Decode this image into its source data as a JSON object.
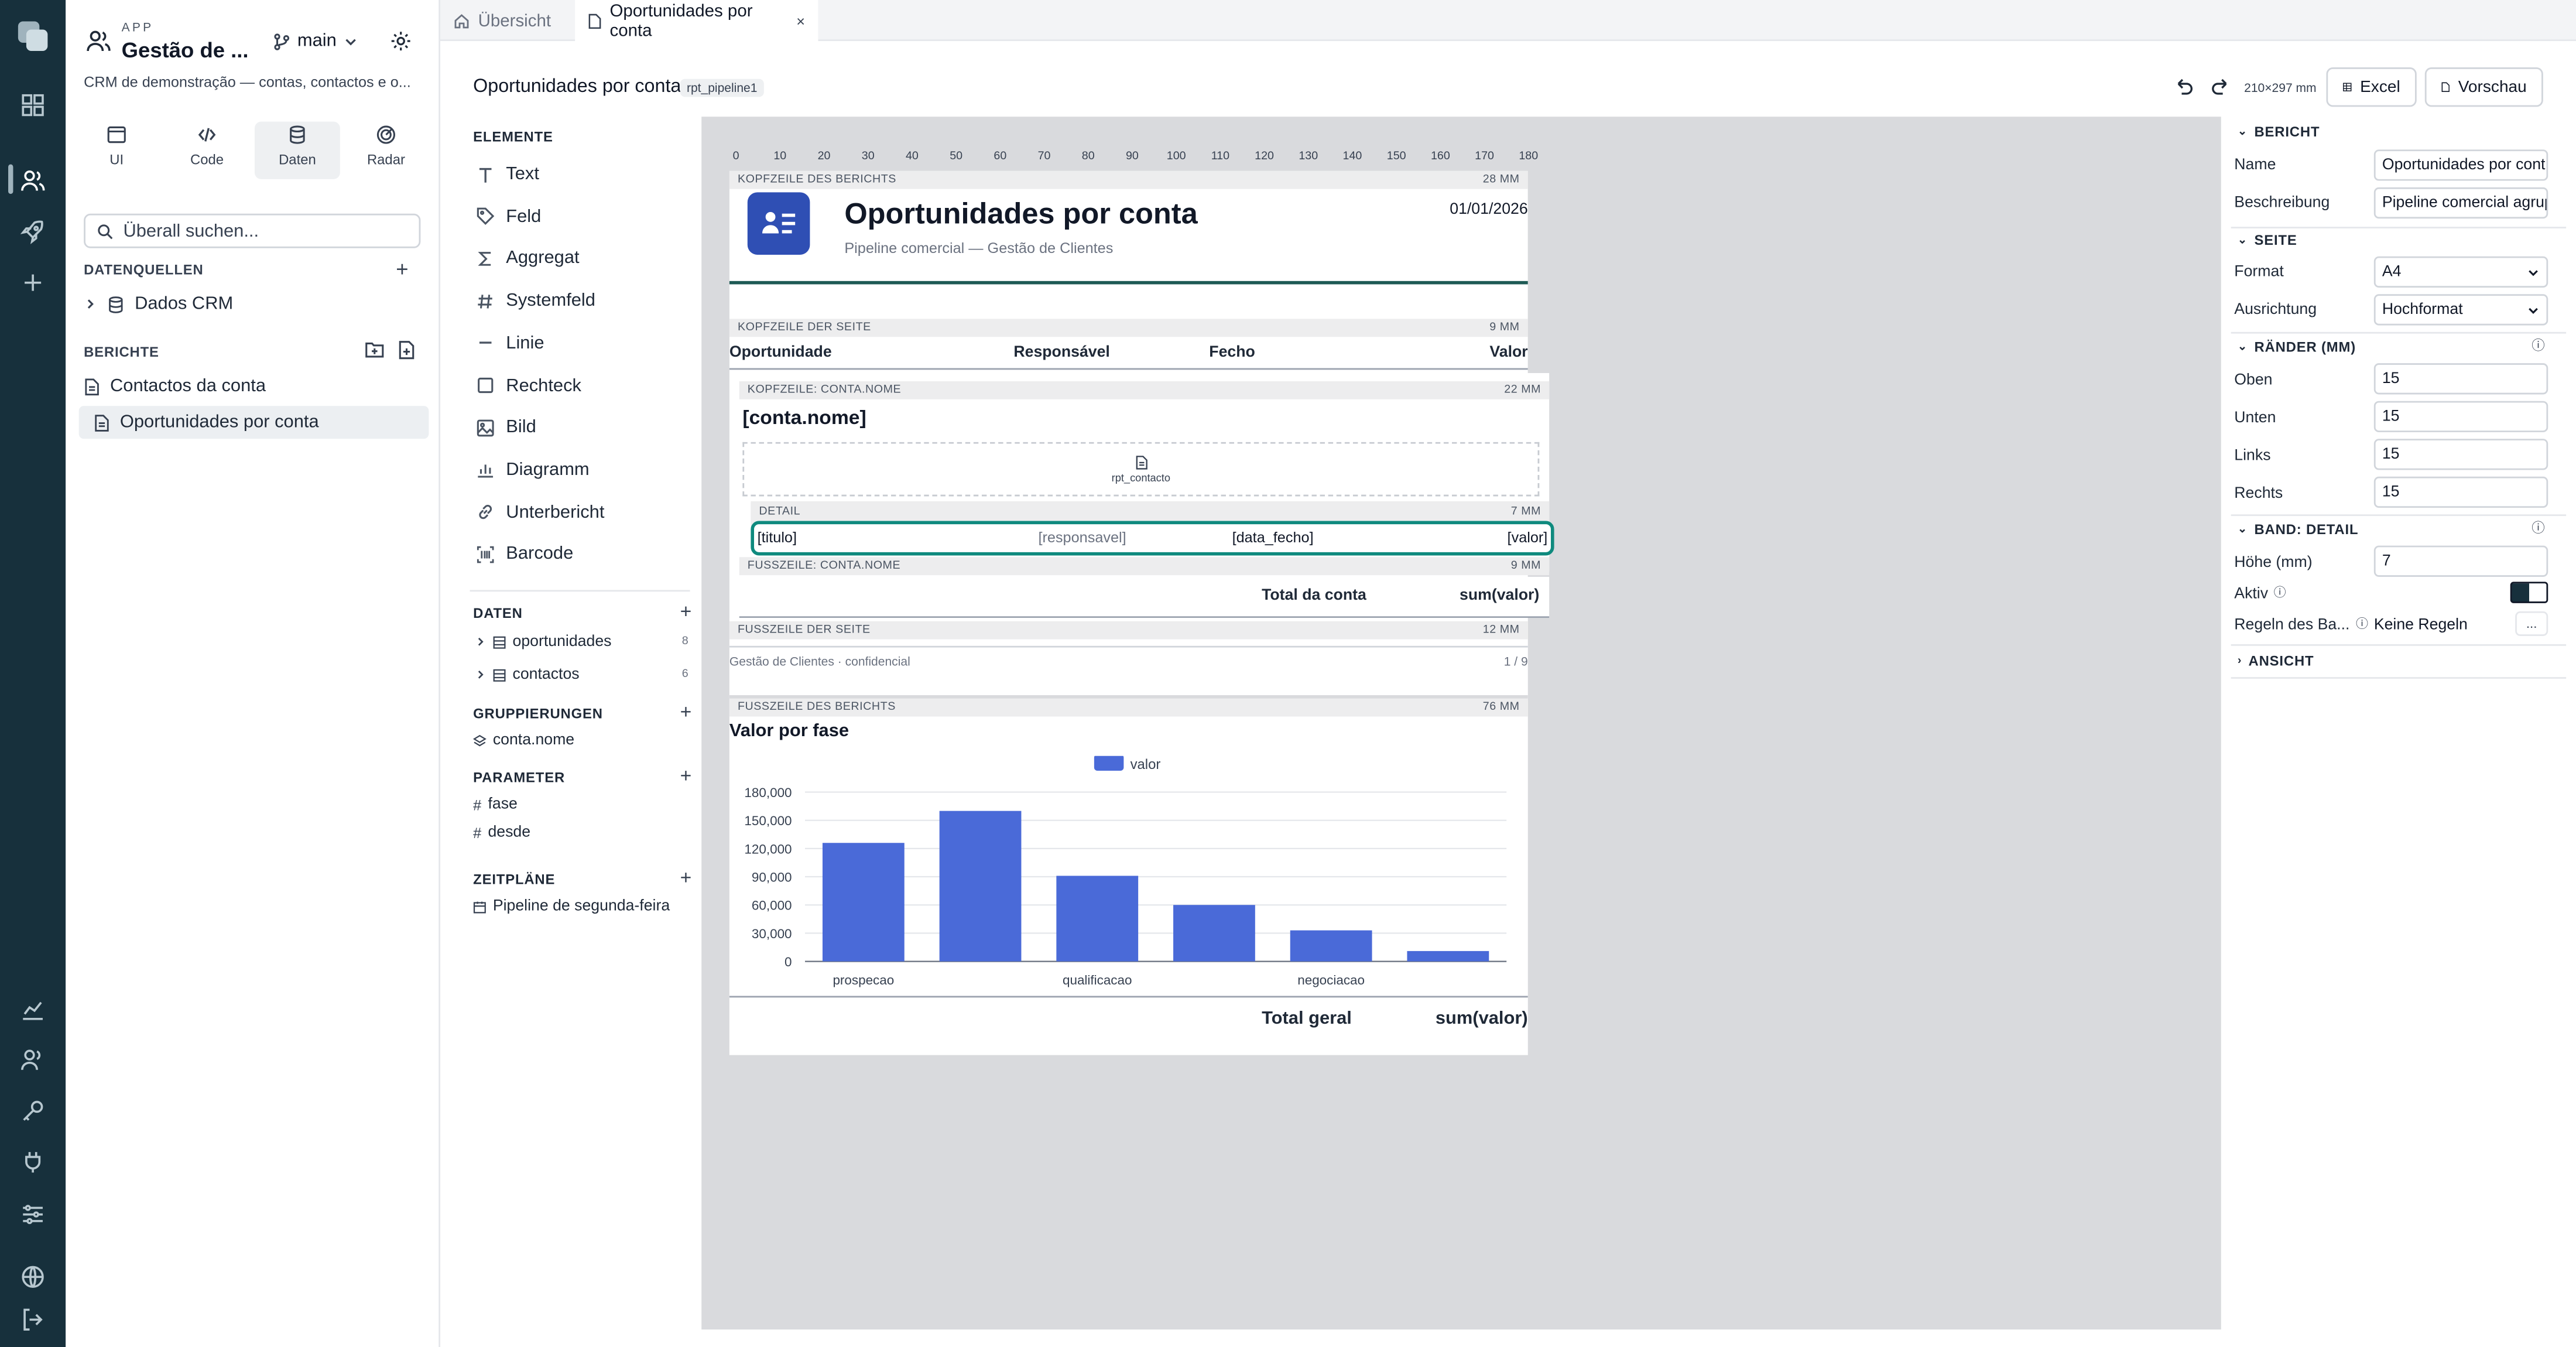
{
  "app": {
    "eyebrow": "APP",
    "title": "Gestão de ...",
    "branch": "main",
    "description": "CRM de demonstração — contas, contactos e o..."
  },
  "modes": [
    {
      "label": "UI"
    },
    {
      "label": "Code"
    },
    {
      "label": "Daten"
    },
    {
      "label": "Radar"
    }
  ],
  "search": {
    "placeholder": "Überall suchen..."
  },
  "datasources": {
    "heading": "DATENQUELLEN",
    "items": [
      {
        "label": "Dados CRM"
      }
    ]
  },
  "reports": {
    "heading": "BERICHTE",
    "items": [
      {
        "label": "Contactos da conta"
      },
      {
        "label": "Oportunidades por conta"
      }
    ]
  },
  "tabs": [
    {
      "label": "Übersicht"
    },
    {
      "label": "Oportunidades por conta"
    }
  ],
  "toolbar": {
    "title": "Oportunidades por conta",
    "badge": "rpt_pipeline1",
    "page_size": "210×297 mm",
    "excel": "Excel",
    "preview": "Vorschau"
  },
  "elements": {
    "heading": "ELEMENTE",
    "items": [
      {
        "label": "Text",
        "icon": "text-icon"
      },
      {
        "label": "Feld",
        "icon": "tag-icon"
      },
      {
        "label": "Aggregat",
        "icon": "sigma-icon"
      },
      {
        "label": "Systemfeld",
        "icon": "hash-icon"
      },
      {
        "label": "Linie",
        "icon": "line-icon"
      },
      {
        "label": "Rechteck",
        "icon": "rectangle-icon"
      },
      {
        "label": "Bild",
        "icon": "image-icon"
      },
      {
        "label": "Diagramm",
        "icon": "chart-icon"
      },
      {
        "label": "Unterbericht",
        "icon": "link-icon"
      },
      {
        "label": "Barcode",
        "icon": "barcode-icon"
      }
    ]
  },
  "data_section": {
    "heading": "DATEN",
    "items": [
      {
        "label": "oportunidades",
        "count": "8"
      },
      {
        "label": "contactos",
        "count": "6"
      }
    ]
  },
  "groupings": {
    "heading": "GRUPPIERUNGEN",
    "items": [
      {
        "label": "conta.nome"
      }
    ]
  },
  "parameters": {
    "heading": "PARAMETER",
    "items": [
      {
        "label": "fase"
      },
      {
        "label": "desde"
      }
    ]
  },
  "schedules": {
    "heading": "ZEITPLÄNE",
    "items": [
      {
        "label": "Pipeline de segunda-feira"
      }
    ]
  },
  "ruler": [
    "0",
    "10",
    "20",
    "30",
    "40",
    "50",
    "60",
    "70",
    "80",
    "90",
    "100",
    "110",
    "120",
    "130",
    "140",
    "150",
    "160",
    "170",
    "180"
  ],
  "report": {
    "report_header": {
      "label": "KOPFZEILE DES BERICHTS",
      "height": "28 MM",
      "title": "Oportunidades por conta",
      "subtitle": "Pipeline comercial — Gestão de Clientes",
      "date": "01/01/2026"
    },
    "page_header": {
      "label": "KOPFZEILE DER SEITE",
      "height": "9 MM",
      "columns": [
        "Oportunidade",
        "Responsável",
        "Fecho",
        "Valor"
      ]
    },
    "group_header": {
      "label": "KOPFZEILE: CONTA.NOME",
      "height": "22 MM",
      "field": "[conta.nome]",
      "subreport": "rpt_contacto"
    },
    "detail": {
      "label": "DETAIL",
      "height": "7 MM",
      "fields": [
        "[titulo]",
        "[responsavel]",
        "[data_fecho]",
        "[valor]"
      ]
    },
    "group_footer": {
      "label": "FUSSZEILE: CONTA.NOME",
      "height": "9 MM",
      "total_label": "Total da conta",
      "total_value": "sum(valor)"
    },
    "page_footer": {
      "label": "FUSSZEILE DER SEITE",
      "height": "12 MM",
      "text": "Gestão de Clientes · confidencial",
      "page": "1 / 9"
    },
    "report_footer": {
      "label": "FUSSZEILE DES BERICHTS",
      "height": "76 MM",
      "chart_title": "Valor por fase",
      "total_label": "Total geral",
      "total_value": "sum(valor)"
    }
  },
  "chart_data": {
    "type": "bar",
    "title": "Valor por fase",
    "categories": [
      "prospecao",
      "",
      "qualificacao",
      "",
      "negociacao",
      ""
    ],
    "series": [
      {
        "name": "valor",
        "values": [
          126000,
          160000,
          91000,
          60000,
          33000,
          11000
        ]
      }
    ],
    "yticks": [
      "180,000",
      "150,000",
      "120,000",
      "90,000",
      "60,000",
      "30,000",
      "0"
    ],
    "ylim": [
      0,
      180000
    ],
    "grid": true,
    "legend": "top-center",
    "color": "#4a6ad8"
  },
  "properties": {
    "bericht": {
      "heading": "BERICHT",
      "name_label": "Name",
      "name_value": "Oportunidades por cont",
      "desc_label": "Beschreibung",
      "desc_value": "Pipeline comercial agrup"
    },
    "seite": {
      "heading": "SEITE",
      "format_label": "Format",
      "format_value": "A4",
      "orient_label": "Ausrichtung",
      "orient_value": "Hochformat"
    },
    "raender": {
      "heading": "RÄNDER (MM)",
      "top_label": "Oben",
      "top": "15",
      "bottom_label": "Unten",
      "bottom": "15",
      "left_label": "Links",
      "left": "15",
      "right_label": "Rechts",
      "right": "15"
    },
    "band": {
      "heading": "BAND: DETAIL",
      "height_label": "Höhe (mm)",
      "height": "7",
      "active_label": "Aktiv",
      "rules_label": "Regeln des Ba...",
      "rules_value": "Keine Regeln",
      "rules_button": "..."
    },
    "ansicht": {
      "heading": "ANSICHT"
    }
  },
  "colors": {
    "rail": "#17303c",
    "accent_teal": "#0f8a7e",
    "brand_blue": "#2f4fb4",
    "bar": "#4a6ad8",
    "header_line": "#1e5a55"
  }
}
